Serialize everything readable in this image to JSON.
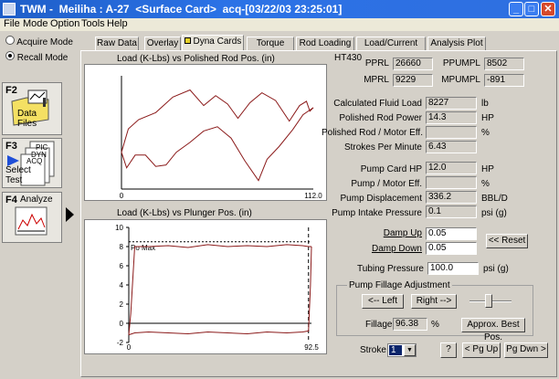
{
  "window": {
    "title": "TWM -  Meiliha : A-27  <Surface Card>  acq-[03/22/03 23:25:01]",
    "minimize": "_",
    "maximize": "□",
    "close": "✕"
  },
  "menu": [
    "File",
    "Mode",
    "Option",
    "Tools",
    "Help"
  ],
  "left": {
    "modes": [
      {
        "label": "Acquire Mode",
        "selected": false
      },
      {
        "label": "Recall Mode",
        "selected": true
      }
    ],
    "fkeys": [
      {
        "key": "F2",
        "label": "Data Files"
      },
      {
        "key": "F3",
        "label": "Select Test",
        "doc_labels": [
          "PIC",
          "DYN",
          "ACQ"
        ]
      },
      {
        "key": "F4",
        "label": "Analyze"
      }
    ]
  },
  "tabs": [
    "Raw Data",
    "Overlay",
    "Dyna Cards",
    "Torque",
    "Rod Loading",
    "Load/Current",
    "Analysis Plot"
  ],
  "active_tab": "Dyna Cards",
  "top_chart": {
    "title": "Load (K-Lbs) vs Polished Rod Pos. (in)",
    "x_min_label": "0",
    "x_max_label": "112.0"
  },
  "bottom_chart": {
    "title": "Load (K-Lbs) vs Plunger Pos. (in)",
    "y_ticks": [
      "10",
      "8",
      "6",
      "4",
      "2",
      "0",
      "-2"
    ],
    "x_min_label": "0",
    "x_max_label": "92.5",
    "annotation": "Po Max"
  },
  "chart_data": [
    {
      "type": "line",
      "title": "Load (K-Lbs) vs Polished Rod Pos. (in)",
      "xlim": [
        0,
        112
      ],
      "series": [
        {
          "x": [
            0,
            4,
            10,
            20,
            30,
            40,
            48,
            55,
            62,
            68,
            75,
            82,
            90,
            98,
            104,
            108,
            110,
            112
          ],
          "y": [
            15.2,
            18.5,
            19.8,
            20.8,
            23.0,
            24.0,
            21.8,
            23.2,
            22.0,
            20.0,
            22.2,
            23.6,
            22.5,
            19.6,
            21.8,
            22.4,
            21.0,
            21.5
          ]
        },
        {
          "x": [
            112,
            106,
            100,
            92,
            85,
            80,
            72,
            64,
            56,
            48,
            40,
            32,
            26,
            20,
            14,
            8,
            3,
            0
          ],
          "y": [
            21.5,
            20.5,
            18.4,
            16.0,
            14.2,
            11.2,
            14.0,
            17.2,
            18.8,
            18.2,
            16.6,
            15.2,
            13.4,
            13.2,
            14.8,
            14.8,
            13.0,
            15.2
          ]
        }
      ]
    },
    {
      "type": "line",
      "title": "Load (K-Lbs) vs Plunger Pos. (in)",
      "xlim": [
        0,
        92.5
      ],
      "ylim": [
        -2,
        10
      ],
      "series": [
        {
          "x": [
            0,
            1,
            3,
            10,
            20,
            30,
            40,
            50,
            60,
            70,
            80,
            88,
            91,
            92.5
          ],
          "y": [
            -1.2,
            1.0,
            8.0,
            8.0,
            8.1,
            7.9,
            8.2,
            8.0,
            8.1,
            8.0,
            8.2,
            8.1,
            8.0,
            8.0
          ]
        },
        {
          "x": [
            92.5,
            92,
            91,
            88,
            80,
            70,
            60,
            50,
            40,
            30,
            20,
            10,
            3,
            0
          ],
          "y": [
            8.0,
            4.0,
            -0.8,
            -0.9,
            -1.0,
            -0.9,
            -1.1,
            -1.0,
            -0.9,
            -1.1,
            -1.0,
            -0.9,
            -1.0,
            -1.2
          ]
        }
      ]
    }
  ],
  "header_fields": {
    "id": "HT430",
    "pprl_label": "PPRL",
    "pprl": "26660",
    "ppumpl_label": "PPUMPL",
    "ppumpl": "8502",
    "mprl_label": "MPRL",
    "mprl": "9229",
    "mpumpl_label": "MPUMPL",
    "mpumpl": "-891"
  },
  "metrics": [
    {
      "label": "Calculated Fluid Load",
      "value": "8227",
      "unit": "lb"
    },
    {
      "label": "Polished Rod Power",
      "value": "14.3",
      "unit": "HP"
    },
    {
      "label": "Polished Rod / Motor Eff.",
      "value": "",
      "unit": "%"
    },
    {
      "label": "Strokes Per Minute",
      "value": "6.43",
      "unit": ""
    },
    {
      "label": "Pump Card HP",
      "value": "12.0",
      "unit": "HP"
    },
    {
      "label": "Pump / Motor Eff.",
      "value": "",
      "unit": "%"
    },
    {
      "label": "Pump Displacement",
      "value": "336.2",
      "unit": "BBL/D"
    },
    {
      "label": "Pump Intake Pressure",
      "value": "0.1",
      "unit": "psi (g)"
    }
  ],
  "damp": {
    "up_label": "Damp Up",
    "up_value": "0.05",
    "down_label": "Damp Down",
    "down_value": "0.05",
    "reset": "<< Reset"
  },
  "tubing": {
    "label": "Tubing Pressure",
    "value": "100.0",
    "unit": "psi (g)"
  },
  "fillage": {
    "group_title": "Pump Fillage Adjustment",
    "left": "<-- Left",
    "right": "Right -->",
    "label": "Fillage",
    "value": "96.38",
    "unit": "%",
    "best": "Approx. Best Pos.",
    "slider_level": 0.45
  },
  "bottom": {
    "stroke_label": "Stroke",
    "stroke_value": "1",
    "help": "?",
    "pgup": "< Pg Up",
    "pgdn": "Pg Dwn >"
  }
}
